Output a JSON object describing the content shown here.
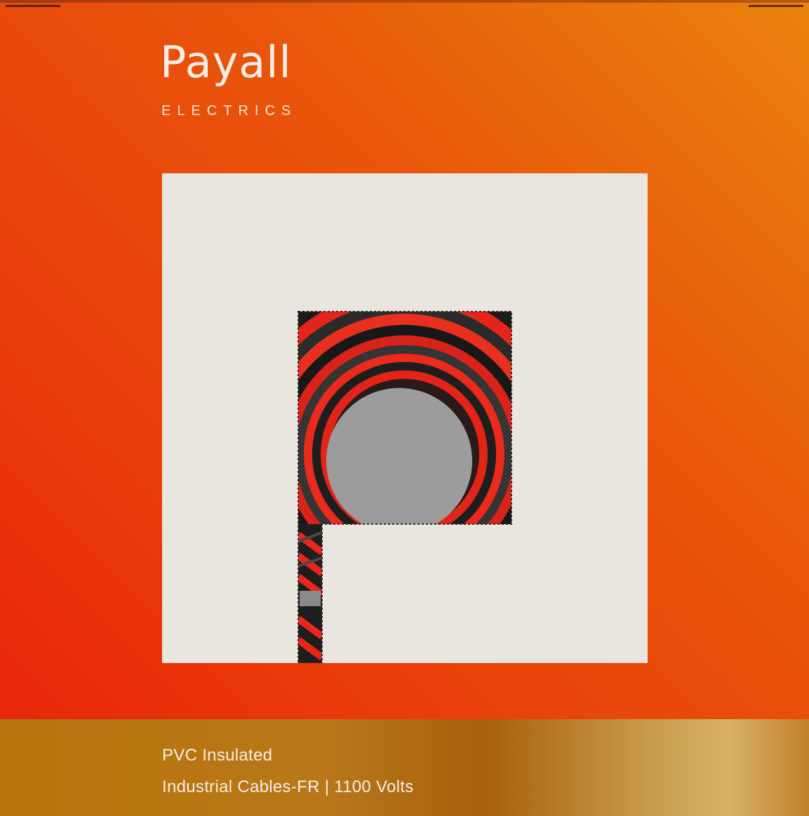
{
  "brand": {
    "name": "Payall",
    "subtitle": "ELECTRICS"
  },
  "logo": {
    "icon": "cable-coil-p-logo-icon"
  },
  "product": {
    "line1": "PVC Insulated",
    "line2": "Industrial Cables-FR | 1100 Volts"
  },
  "colors": {
    "background_orange": "#e9400b",
    "panel_cream": "#e9e6df",
    "band_gold": "#b87611",
    "cable_red": "#e8261a",
    "cable_black": "#1e1e1e",
    "cable_grey": "#9a9a9a"
  }
}
